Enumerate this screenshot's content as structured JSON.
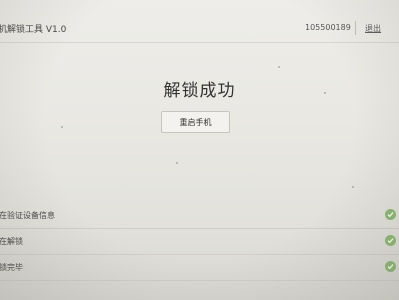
{
  "header": {
    "app_title": "机解锁工具 V1.0",
    "device_id": "105500189",
    "exit_label": "退出"
  },
  "main": {
    "status_title": "解锁成功",
    "restart_button": "重启手机"
  },
  "steps": [
    {
      "label": "在验证设备信息",
      "status_icon": "check-icon"
    },
    {
      "label": "在解锁",
      "status_icon": "check-icon"
    },
    {
      "label": "锁完毕",
      "status_icon": "check-icon"
    }
  ],
  "colors": {
    "background": "#eceae6",
    "check": "#8ab86e"
  }
}
